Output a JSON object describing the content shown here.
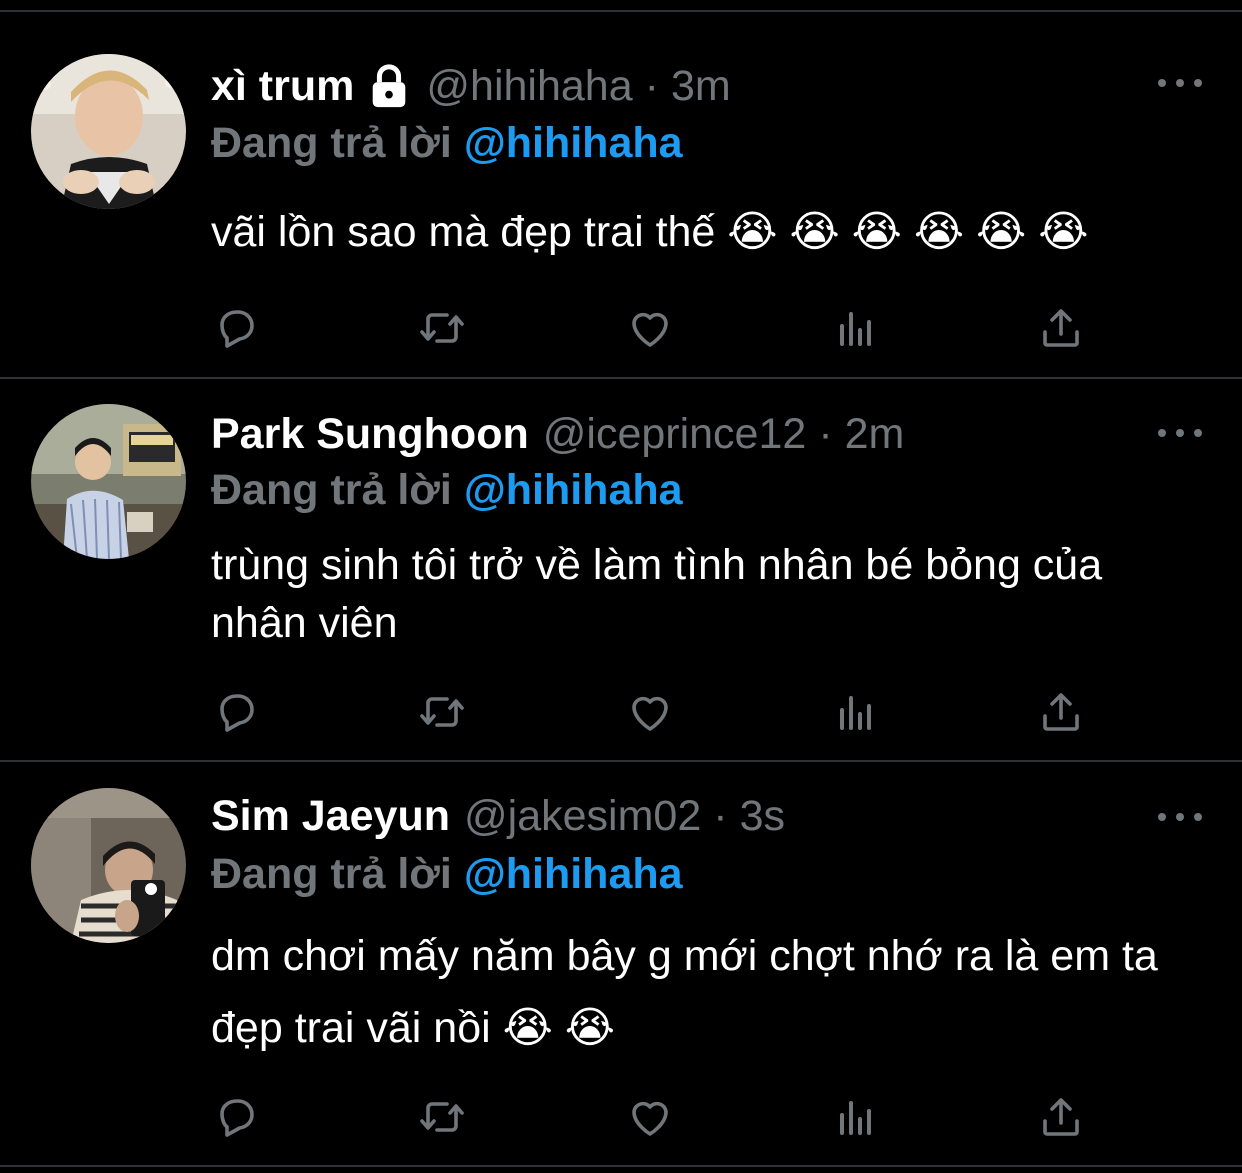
{
  "tweets": [
    {
      "display_name": "xì trum",
      "handle": "@hihihaha",
      "separator": "·",
      "time": "3m",
      "protected": true,
      "reply_prefix": "Đang trả lời",
      "reply_to": "@hihihaha",
      "text": "vãi lồn sao mà đẹp trai thế 😭 😭 😭 😭 😭 😭"
    },
    {
      "display_name": "Park Sunghoon",
      "handle": "@iceprince12",
      "separator": "·",
      "time": "2m",
      "protected": false,
      "reply_prefix": "Đang trả lời",
      "reply_to": "@hihihaha",
      "text": "trùng sinh tôi trở về làm tình nhân bé bỏng của nhân viên"
    },
    {
      "display_name": "Sim Jaeyun",
      "handle": "@jakesim02",
      "separator": "·",
      "time": "3s",
      "protected": false,
      "reply_prefix": "Đang trả lời",
      "reply_to": "@hihihaha",
      "text": "dm chơi mấy năm bây g mới chợt nhớ ra là em ta đẹp trai vãi nồi 😭 😭"
    }
  ],
  "icons": {
    "reply": "reply-icon",
    "retweet": "retweet-icon",
    "like": "heart-icon",
    "analytics": "analytics-icon",
    "share": "share-icon",
    "more": "more-icon",
    "lock": "lock-icon"
  },
  "colors": {
    "background": "#000000",
    "text": "#ffffff",
    "muted": "#71767b",
    "accent": "#1d9bf0",
    "divider": "#2f3336"
  }
}
